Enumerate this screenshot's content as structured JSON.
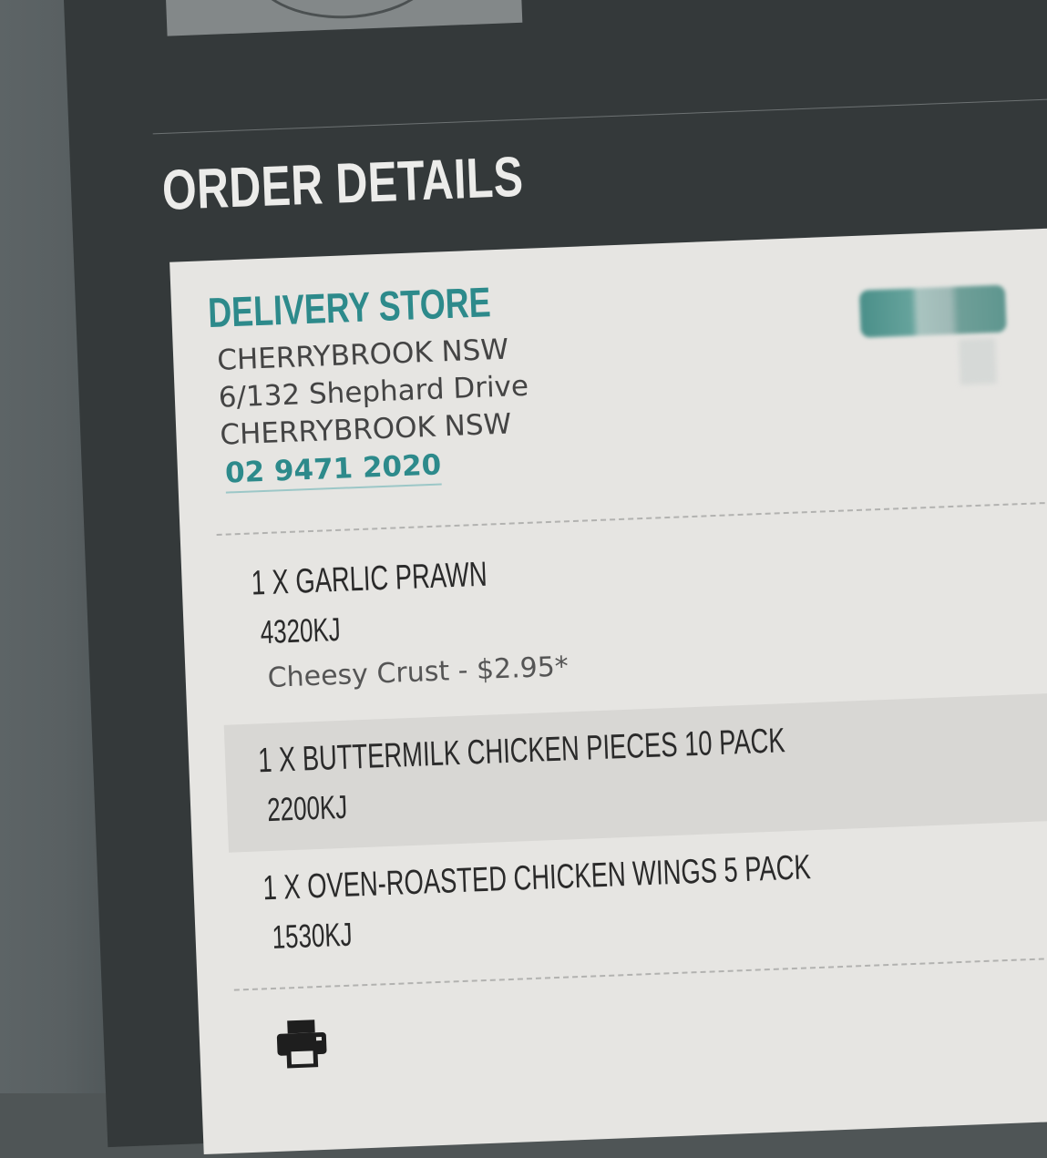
{
  "page": {
    "heading": "ORDER DETAILS"
  },
  "store": {
    "title": "DELIVERY STORE",
    "name": "CHERRYBROOK NSW",
    "street": "6/132 Shephard Drive",
    "suburb": "CHERRYBROOK NSW",
    "phone": "02 9471 2020"
  },
  "items": [
    {
      "name": "1 X GARLIC PRAWN",
      "energy": "4320KJ",
      "option": "Cheesy Crust - $2.95*"
    },
    {
      "name": "1 X BUTTERMILK CHICKEN PIECES 10 PACK",
      "energy": "2200KJ"
    },
    {
      "name": "1 X OVEN-ROASTED CHICKEN WINGS 5 PACK",
      "energy": "1530KJ"
    }
  ],
  "icons": {
    "print": "printer-icon"
  },
  "colors": {
    "accent": "#2d8a8b",
    "card_background": "#e6e5e2",
    "page_background": "#34393a"
  }
}
